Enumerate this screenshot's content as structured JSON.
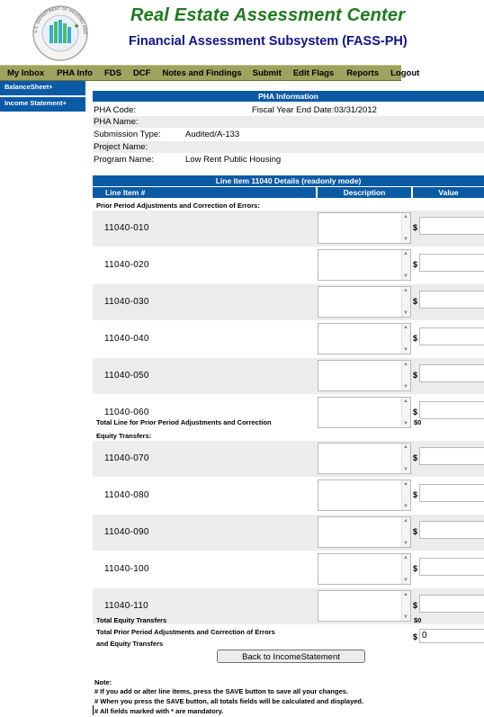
{
  "header": {
    "title": "Real Estate Assessment Center",
    "subtitle": "Financial Assessment Subsystem (FASS-PH)",
    "seal_text": "U.S. DEPARTMENT OF HOUSING AND URBAN DEVELOPMENT"
  },
  "nav": [
    "My Inbox",
    "PHA Info",
    "FDS",
    "DCF",
    "Notes and Findings",
    "Submit",
    "Edit Flags",
    "Reports",
    "Logout"
  ],
  "sidebar": [
    "BalanceSheet+",
    "Income Statement+"
  ],
  "pha_info": {
    "header": "PHA Information",
    "pha_code_label": "PHA Code:",
    "pha_code": "",
    "fye": "Fiscal Year End Date:03/31/2012",
    "pha_name_label": "PHA Name:",
    "pha_name": "",
    "submission_type_label": "Submission Type:",
    "submission_type": "Audited/A-133",
    "project_name_label": "Project Name:",
    "project_name": "",
    "program_name_label": "Program Name:",
    "program_name": "Low Rent Public Housing"
  },
  "line_item": {
    "header": "Line Item 11040 Details (readonly mode)",
    "columns": [
      "Line Item #",
      "Description",
      "Value"
    ],
    "section1_label": "Prior Period Adjustments and Correction of Errors:",
    "section1_rows": [
      "11040-010",
      "11040-020",
      "11040-030",
      "11040-040",
      "11040-050",
      "11040-060"
    ],
    "total1_label": "Total Line for Prior Period Adjustments and Correction",
    "total1_value": "$0",
    "section2_label": "Equity Transfers:",
    "section2_rows": [
      "11040-070",
      "11040-080",
      "11040-090",
      "11040-100",
      "11040-110"
    ],
    "total2_label": "Total Equity Transfers",
    "total2_value": "$0",
    "total3_label_line1": "Total Prior Period Adjustments and Correction of Errors",
    "total3_label_line2": "and Equity Transfers",
    "total3_dollar": "$",
    "total3_value": "0",
    "currency": "$"
  },
  "back_button": "Back to IncomeStatement",
  "notes": {
    "title": "Note:",
    "lines": [
      "# If you add or alter line items, press the SAVE button to save all your changes.",
      "# When you press the SAVE button, all totals fields will be calculated and displayed.",
      "# All fields marked with * are mandatory."
    ]
  },
  "colors": {
    "title_green": "#1d7a1d",
    "subtitle_navy": "#12128a",
    "nav_olive": "#9ea35f",
    "header_blue": "#0b5aa6",
    "row_gray": "#ececec"
  }
}
